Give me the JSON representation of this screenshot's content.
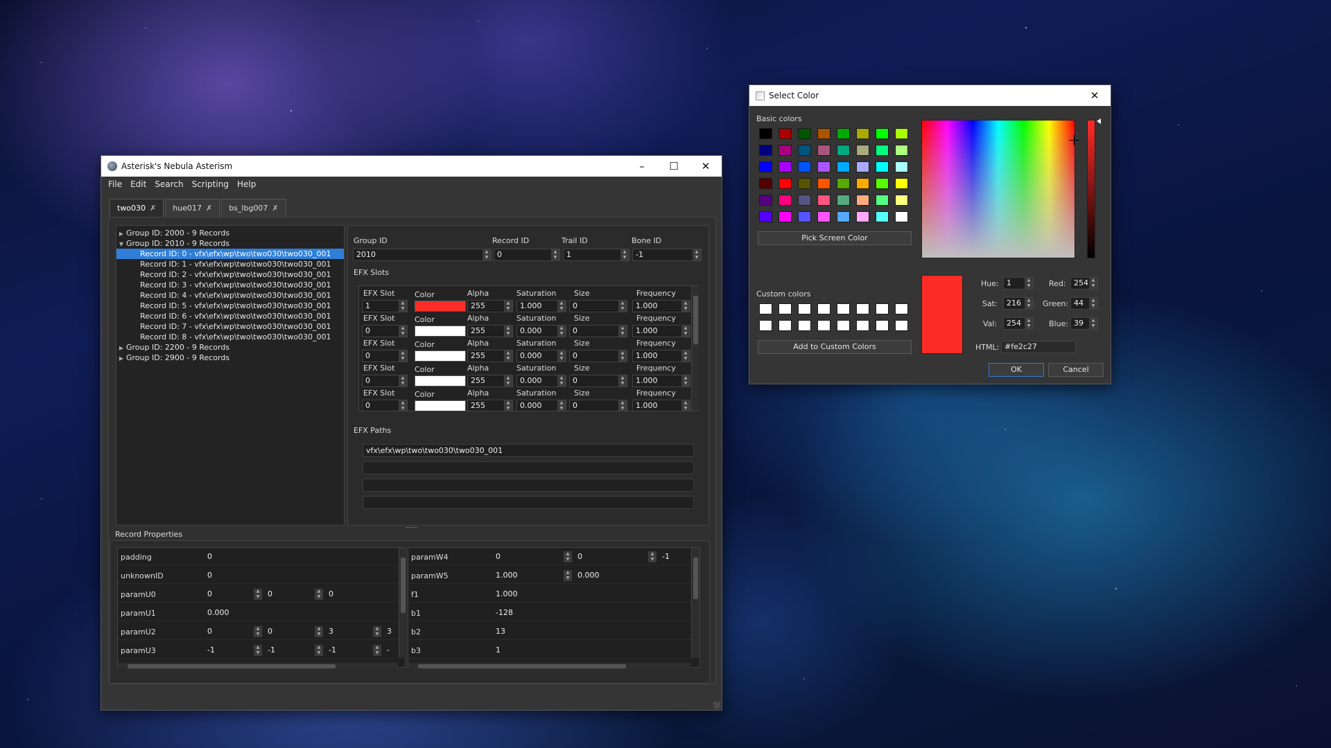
{
  "main": {
    "title": "Asterisk's Nebula Asterism",
    "menu": [
      "File",
      "Edit",
      "Search",
      "Scripting",
      "Help"
    ],
    "tabs": [
      "two030",
      "hue017",
      "bs_lbg007"
    ],
    "tree": [
      {
        "label": "Group ID: 2000 - 9 Records",
        "kind": "group",
        "open": false
      },
      {
        "label": "Group ID: 2010 - 9 Records",
        "kind": "group",
        "open": true
      },
      {
        "label": "Record ID: 0 - vfx\\efx\\wp\\two\\two030\\two030_001",
        "kind": "rec",
        "sel": true
      },
      {
        "label": "Record ID: 1 - vfx\\efx\\wp\\two\\two030\\two030_001",
        "kind": "rec"
      },
      {
        "label": "Record ID: 2 - vfx\\efx\\wp\\two\\two030\\two030_001",
        "kind": "rec"
      },
      {
        "label": "Record ID: 3 - vfx\\efx\\wp\\two\\two030\\two030_001",
        "kind": "rec"
      },
      {
        "label": "Record ID: 4 - vfx\\efx\\wp\\two\\two030\\two030_001",
        "kind": "rec"
      },
      {
        "label": "Record ID: 5 - vfx\\efx\\wp\\two\\two030\\two030_001",
        "kind": "rec"
      },
      {
        "label": "Record ID: 6 - vfx\\efx\\wp\\two\\two030\\two030_001",
        "kind": "rec"
      },
      {
        "label": "Record ID: 7 - vfx\\efx\\wp\\two\\two030\\two030_001",
        "kind": "rec"
      },
      {
        "label": "Record ID: 8 - vfx\\efx\\wp\\two\\two030\\two030_001",
        "kind": "rec"
      },
      {
        "label": "Group ID: 2200 - 9 Records",
        "kind": "group",
        "open": false
      },
      {
        "label": "Group ID: 2900 - 9 Records",
        "kind": "group",
        "open": false
      }
    ],
    "ids": {
      "group_label": "Group ID",
      "group_val": "2010",
      "record_label": "Record ID",
      "record_val": "0",
      "trail_label": "Trail ID",
      "trail_val": "1",
      "bone_label": "Bone ID",
      "bone_val": "-1"
    },
    "efx_slots_title": "EFX Slots",
    "slot_headers": {
      "slot": "EFX Slot",
      "color": "Color",
      "alpha": "Alpha",
      "sat": "Saturation",
      "size": "Size",
      "freq": "Frequency"
    },
    "slots": [
      {
        "slot": "1",
        "color": "#fe2c27",
        "alpha": "255",
        "sat": "1.000",
        "size": "0",
        "freq": "1.000"
      },
      {
        "slot": "0",
        "color": "#ffffff",
        "alpha": "255",
        "sat": "0.000",
        "size": "0",
        "freq": "1.000"
      },
      {
        "slot": "0",
        "color": "#ffffff",
        "alpha": "255",
        "sat": "0.000",
        "size": "0",
        "freq": "1.000"
      },
      {
        "slot": "0",
        "color": "#ffffff",
        "alpha": "255",
        "sat": "0.000",
        "size": "0",
        "freq": "1.000"
      },
      {
        "slot": "0",
        "color": "#ffffff",
        "alpha": "255",
        "sat": "0.000",
        "size": "0",
        "freq": "1.000"
      }
    ],
    "efx_paths_title": "EFX Paths",
    "paths": [
      "vfx\\efx\\wp\\two\\two030\\two030_001",
      "",
      "",
      ""
    ],
    "record_props_title": "Record Properties",
    "props_left": [
      {
        "name": "padding",
        "vals": [
          "0"
        ]
      },
      {
        "name": "unknownID",
        "vals": [
          "0"
        ]
      },
      {
        "name": "paramU0",
        "vals": [
          "0",
          "0",
          "0"
        ]
      },
      {
        "name": "paramU1",
        "vals": [
          "0.000"
        ]
      },
      {
        "name": "paramU2",
        "vals": [
          "0",
          "0",
          "3",
          "3"
        ]
      },
      {
        "name": "paramU3",
        "vals": [
          "-1",
          "-1",
          "-1",
          "-"
        ]
      }
    ],
    "props_right": [
      {
        "name": "paramW4",
        "vals": [
          "0",
          "0",
          "-1"
        ]
      },
      {
        "name": "paramW5",
        "vals": [
          "1.000",
          "0.000"
        ]
      },
      {
        "name": "f1",
        "vals": [
          "1.000"
        ]
      },
      {
        "name": "b1",
        "vals": [
          "-128"
        ]
      },
      {
        "name": "b2",
        "vals": [
          "13"
        ]
      },
      {
        "name": "b3",
        "vals": [
          "1"
        ]
      }
    ]
  },
  "dialog": {
    "title": "Select Color",
    "basic_label": "Basic colors",
    "custom_label": "Custom colors",
    "pick_label": "Pick Screen Color",
    "add_label": "Add to Custom Colors",
    "basic_colors": [
      "#000000",
      "#aa0000",
      "#005500",
      "#aa5500",
      "#00aa00",
      "#aaaa00",
      "#00ff00",
      "#aaff00",
      "#00007f",
      "#aa007f",
      "#00557f",
      "#aa557f",
      "#00aa7f",
      "#aaaa7f",
      "#00ff7f",
      "#aaff7f",
      "#0000ff",
      "#aa00ff",
      "#0055ff",
      "#aa55ff",
      "#00aaff",
      "#aaaaff",
      "#00ffff",
      "#aaffff",
      "#550000",
      "#ff0000",
      "#555500",
      "#ff5500",
      "#55aa00",
      "#ffaa00",
      "#55ff00",
      "#ffff00",
      "#55007f",
      "#ff007f",
      "#55557f",
      "#ff557f",
      "#55aa7f",
      "#ffaa7f",
      "#55ff7f",
      "#ffff7f",
      "#5500ff",
      "#ff00ff",
      "#5555ff",
      "#ff55ff",
      "#55aaff",
      "#ffaaff",
      "#55ffff",
      "#ffffff"
    ],
    "fields": {
      "hue_label": "Hue:",
      "hue": "1",
      "sat_label": "Sat:",
      "sat": "216",
      "val_label": "Val:",
      "val": "254",
      "red_label": "Red:",
      "red": "254",
      "green_label": "Green:",
      "green": "44",
      "blue_label": "Blue:",
      "blue": "39",
      "html_label": "HTML:",
      "html": "#fe2c27"
    },
    "ok": "OK",
    "cancel": "Cancel",
    "preview": "#fe2c27"
  }
}
